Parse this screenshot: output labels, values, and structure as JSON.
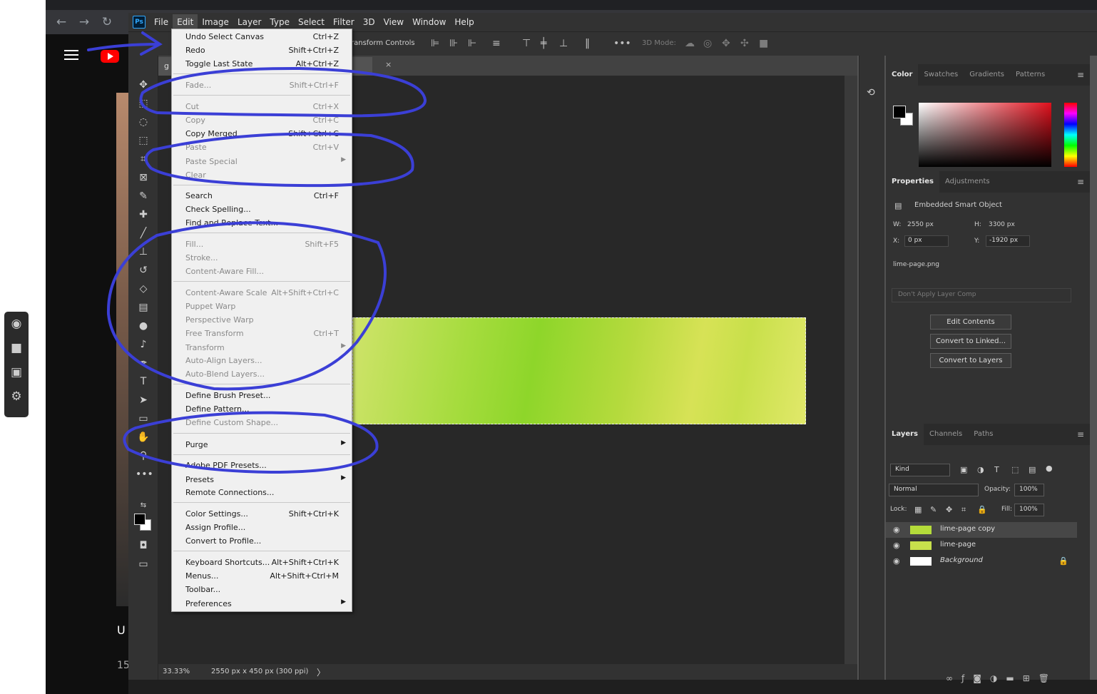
{
  "photoshop": {
    "logo_text": "Ps",
    "menubar": [
      "File",
      "Edit",
      "Image",
      "Layer",
      "Type",
      "Select",
      "Filter",
      "3D",
      "View",
      "Window",
      "Help"
    ],
    "options_bar": {
      "transform_controls": "ransform Controls",
      "mode_3d": "3D Mode:"
    },
    "document_tab": {
      "title": "g",
      "close": "×"
    },
    "status": {
      "zoom": "33.33%",
      "doc_size": "2550 px x 450 px (300 ppi)",
      "arrow": "〉"
    }
  },
  "edit_menu": {
    "items": [
      {
        "label": "Undo Select Canvas",
        "shortcut": "Ctrl+Z"
      },
      {
        "label": "Redo",
        "shortcut": "Shift+Ctrl+Z"
      },
      {
        "label": "Toggle Last State",
        "shortcut": "Alt+Ctrl+Z"
      },
      {
        "label": "Fade...",
        "shortcut": "Shift+Ctrl+F"
      },
      {
        "label": "Cut",
        "shortcut": "Ctrl+X"
      },
      {
        "label": "Copy",
        "shortcut": "Ctrl+C"
      },
      {
        "label": "Copy Merged",
        "shortcut": "Shift+Ctrl+C"
      },
      {
        "label": "Paste",
        "shortcut": "Ctrl+V"
      },
      {
        "label": "Paste Special",
        "shortcut": ""
      },
      {
        "label": "Clear",
        "shortcut": ""
      },
      {
        "label": "Search",
        "shortcut": "Ctrl+F"
      },
      {
        "label": "Check Spelling...",
        "shortcut": ""
      },
      {
        "label": "Find and Replace Text...",
        "shortcut": ""
      },
      {
        "label": "Fill...",
        "shortcut": "Shift+F5"
      },
      {
        "label": "Stroke...",
        "shortcut": ""
      },
      {
        "label": "Content-Aware Fill...",
        "shortcut": ""
      },
      {
        "label": "Content-Aware Scale",
        "shortcut": "Alt+Shift+Ctrl+C"
      },
      {
        "label": "Puppet Warp",
        "shortcut": ""
      },
      {
        "label": "Perspective Warp",
        "shortcut": ""
      },
      {
        "label": "Free Transform",
        "shortcut": "Ctrl+T"
      },
      {
        "label": "Transform",
        "shortcut": ""
      },
      {
        "label": "Auto-Align Layers...",
        "shortcut": ""
      },
      {
        "label": "Auto-Blend Layers...",
        "shortcut": ""
      },
      {
        "label": "Define Brush Preset...",
        "shortcut": ""
      },
      {
        "label": "Define Pattern...",
        "shortcut": ""
      },
      {
        "label": "Define Custom Shape...",
        "shortcut": ""
      },
      {
        "label": "Purge",
        "shortcut": ""
      },
      {
        "label": "Adobe PDF Presets...",
        "shortcut": ""
      },
      {
        "label": "Presets",
        "shortcut": ""
      },
      {
        "label": "Remote Connections...",
        "shortcut": ""
      },
      {
        "label": "Color Settings...",
        "shortcut": "Shift+Ctrl+K"
      },
      {
        "label": "Assign Profile...",
        "shortcut": ""
      },
      {
        "label": "Convert to Profile...",
        "shortcut": ""
      },
      {
        "label": "Keyboard Shortcuts...",
        "shortcut": "Alt+Shift+Ctrl+K"
      },
      {
        "label": "Menus...",
        "shortcut": "Alt+Shift+Ctrl+M"
      },
      {
        "label": "Toolbar...",
        "shortcut": ""
      },
      {
        "label": "Preferences",
        "shortcut": ""
      }
    ]
  },
  "color_panel": {
    "tabs": [
      "Color",
      "Swatches",
      "Gradients",
      "Patterns"
    ]
  },
  "properties_panel": {
    "tabs": [
      "Properties",
      "Adjustments"
    ],
    "type": "Embedded Smart Object",
    "w_label": "W:",
    "w_value": "2550 px",
    "h_label": "H:",
    "h_value": "3300 px",
    "x_label": "X:",
    "x_value": "0 px",
    "y_label": "Y:",
    "y_value": "-1920 px",
    "filename": "lime-page.png",
    "layer_comp": "Don't Apply Layer Comp",
    "buttons": [
      "Edit Contents",
      "Convert to Linked...",
      "Convert to Layers"
    ]
  },
  "layers_panel": {
    "tabs": [
      "Layers",
      "Channels",
      "Paths"
    ],
    "filter": "Kind",
    "blend_mode": "Normal",
    "opacity_label": "Opacity:",
    "opacity": "100%",
    "lock_label": "Lock:",
    "fill_label": "Fill:",
    "fill": "100%",
    "layers": [
      {
        "name": "lime-page copy"
      },
      {
        "name": "lime-page"
      },
      {
        "name": "Background"
      }
    ]
  },
  "youtube": {
    "text_u": "U",
    "text_15": "15"
  },
  "colors": {
    "lime": "#a6dc3e",
    "annotation": "#3b3fd6",
    "menu_bg": "#f0f0f0"
  }
}
